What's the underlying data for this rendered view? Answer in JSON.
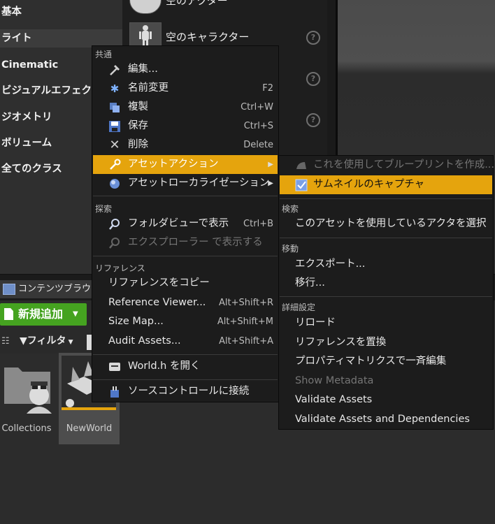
{
  "placement_panel": {
    "categories": [
      "基本",
      "ライト",
      "Cinematic",
      "ビジュアルエフェクト",
      "ジオメトリ",
      "ボリューム",
      "全てのクラス"
    ],
    "assets": [
      {
        "label": "空のアクター"
      },
      {
        "label": "空のキャラクター"
      }
    ]
  },
  "content_browser": {
    "tab_label": "コンテンツブラウザ",
    "add_new_label": "新規追加",
    "filter_label": "フィルタ",
    "tiles": [
      {
        "label": "Collections"
      },
      {
        "label": "NewWorld"
      }
    ]
  },
  "context_menu": {
    "sections": {
      "common": "共通",
      "explore": "探索",
      "references": "リファレンス"
    },
    "items": [
      {
        "label": "編集...",
        "shortcut": "",
        "icon": "hammer-icon"
      },
      {
        "label": "名前変更",
        "shortcut": "F2",
        "icon": "rename-icon"
      },
      {
        "label": "複製",
        "shortcut": "Ctrl+W",
        "icon": "duplicate-icon"
      },
      {
        "label": "保存",
        "shortcut": "Ctrl+S",
        "icon": "save-icon"
      },
      {
        "label": "削除",
        "shortcut": "Delete",
        "icon": "delete-icon"
      },
      {
        "label": "アセットアクション",
        "shortcut": "",
        "icon": "wrench-icon"
      },
      {
        "label": "アセットローカライゼーション",
        "shortcut": "",
        "icon": "globe-icon"
      },
      {
        "label": "フォルダビューで表示",
        "shortcut": "Ctrl+B",
        "icon": "magnifier-icon"
      },
      {
        "label": "エクスプローラー で表示する",
        "shortcut": "",
        "icon": "magnifier-icon"
      },
      {
        "label": "リファレンスをコピー",
        "shortcut": ""
      },
      {
        "label": "Reference Viewer...",
        "shortcut": "Alt+Shift+R"
      },
      {
        "label": "Size Map...",
        "shortcut": "Alt+Shift+M"
      },
      {
        "label": "Audit Assets...",
        "shortcut": "Alt+Shift+A"
      },
      {
        "label": "World.h を開く",
        "shortcut": "",
        "icon": "code-icon"
      },
      {
        "label": "ソースコントロールに接続",
        "shortcut": "",
        "icon": "source-control-icon"
      }
    ]
  },
  "submenu": {
    "sections": {
      "search": "検索",
      "move": "移動",
      "advanced": "詳細設定"
    },
    "items": [
      {
        "label": "これを使用してブループリントを作成..."
      },
      {
        "label": "サムネイルのキャプチャ"
      },
      {
        "label": "このアセットを使用しているアクタを選択"
      },
      {
        "label": "エクスポート..."
      },
      {
        "label": "移行..."
      },
      {
        "label": "リロード"
      },
      {
        "label": "リファレンスを置換"
      },
      {
        "label": "プロパティマトリクスで一斉編集"
      },
      {
        "label": "Show Metadata"
      },
      {
        "label": "Validate Assets"
      },
      {
        "label": "Validate Assets and Dependencies"
      }
    ]
  },
  "colors": {
    "highlight": "#e5a40d",
    "add_button": "#45a320",
    "menu_bg": "#1c1c1c"
  }
}
